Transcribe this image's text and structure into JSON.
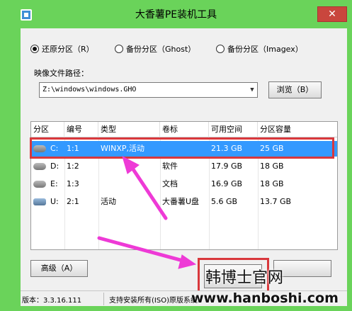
{
  "window": {
    "title": "大香薯PE装机工具",
    "close_glyph": "✕"
  },
  "mode_options": [
    {
      "label": "还原分区（R）",
      "selected": true
    },
    {
      "label": "备份分区（Ghost）",
      "selected": false
    },
    {
      "label": "备份分区（Imagex）",
      "selected": false
    }
  ],
  "image_path": {
    "label": "映像文件路径：",
    "value": "Z:\\windows\\windows.GHO",
    "browse_label": "浏览（B）"
  },
  "partition_table": {
    "columns": [
      "分区",
      "编号",
      "类型",
      "卷标",
      "可用空间",
      "分区容量"
    ],
    "rows": [
      {
        "drive": "C:",
        "number": "1:1",
        "type": "WINXP,活动",
        "label": "",
        "free": "21.3 GB",
        "size": "25 GB",
        "icon": "disk-icon",
        "selected": true
      },
      {
        "drive": "D:",
        "number": "1:2",
        "type": "",
        "label": "软件",
        "free": "17.9 GB",
        "size": "18 GB",
        "icon": "disk-icon",
        "selected": false
      },
      {
        "drive": "E:",
        "number": "1:3",
        "type": "",
        "label": "文档",
        "free": "16.9 GB",
        "size": "18 GB",
        "icon": "disk-icon",
        "selected": false
      },
      {
        "drive": "U:",
        "number": "2:1",
        "type": "活动",
        "label": "大番薯U盘",
        "free": "5.6 GB",
        "size": "13.7 GB",
        "icon": "usb-icon",
        "selected": false
      }
    ]
  },
  "buttons": {
    "advanced_label": "高级（A）"
  },
  "status": {
    "version": "版本：3.3.16.111",
    "copyright": "支持安装所有(ISO)原版系统"
  },
  "watermark": {
    "line1": "韩博士官网",
    "line2": "www.hanboshi.com"
  },
  "colors": {
    "chrome": "#6ad35a",
    "selection": "#3399ff",
    "annotation": "#d9383c",
    "arrow": "#ee3ad6"
  }
}
